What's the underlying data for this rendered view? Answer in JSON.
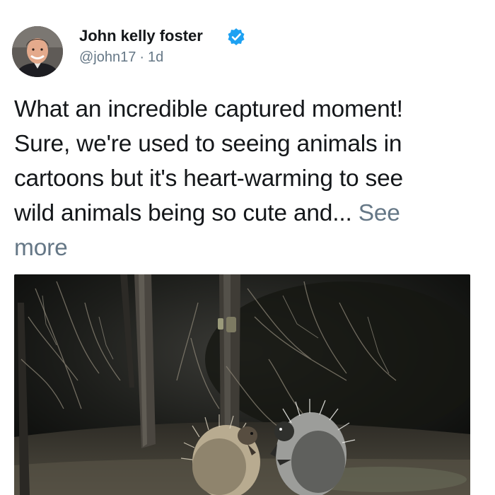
{
  "tweet": {
    "author": {
      "name": "John kelly foster",
      "handle": "@john17",
      "separator": "·",
      "time": "1d",
      "verified": true
    },
    "text_lines": [
      "What an incredible captured moment!",
      "Sure, we're used to seeing animals in",
      "cartoons but it's heart-warming to see",
      "wild animals being so cute and..."
    ],
    "see_more_part1": "See",
    "see_more_part2": "more",
    "media": {
      "type": "photo",
      "subject": "two porcupines at night in a forest clearing"
    }
  },
  "colors": {
    "text": "#14171a",
    "secondary": "#657786",
    "verified_badge": "#1da1f2"
  },
  "icons": {
    "verified": "verified-badge-icon"
  }
}
